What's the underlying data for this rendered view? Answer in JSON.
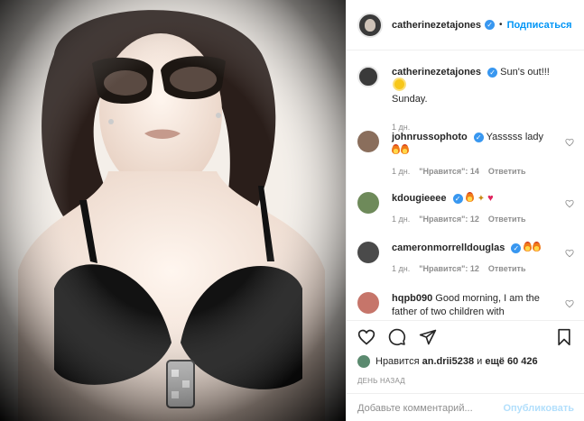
{
  "post": {
    "username": "catherinezetajones",
    "follow_label": "Подписаться",
    "separator": "•"
  },
  "caption": {
    "username": "catherinezetajones",
    "text": "Sun's out!!!",
    "text2": "Sunday.",
    "time": "1 дн."
  },
  "comments": [
    {
      "username": "johnrussophoto",
      "text": "Yasssss lady",
      "time": "1 дн.",
      "likes": "\"Нравится\": 14",
      "reply": "Ответить",
      "verified": true
    },
    {
      "username": "kdougieeee",
      "text": "",
      "time": "1 дн.",
      "likes": "\"Нравится\": 12",
      "reply": "Ответить",
      "verified": true
    },
    {
      "username": "cameronmorrelldouglas",
      "text": "",
      "time": "1 дн.",
      "likes": "\"Нравится\": 12",
      "reply": "Ответить",
      "verified": true
    },
    {
      "username": "hqpb090",
      "text": "Good morning, I am the father of two children with",
      "time": "",
      "likes": "",
      "reply": "",
      "verified": false
    }
  ],
  "likes": {
    "prefix": "Нравится",
    "user": "an.drii5238",
    "middle": "и",
    "count": "ещё 60 426"
  },
  "date": "ДЕНЬ НАЗАД",
  "add_comment": {
    "placeholder": "Добавьте комментарий...",
    "publish_label": "Опубликовать"
  },
  "icons": [
    "heart-icon",
    "comment-icon",
    "share-icon",
    "bookmark-icon",
    "verified-icon",
    "fire-emoji-icon",
    "sun-emoji-icon"
  ],
  "colors": {
    "accent": "#0095f6",
    "verified": "#3897f0",
    "muted": "#8e8e8e"
  }
}
